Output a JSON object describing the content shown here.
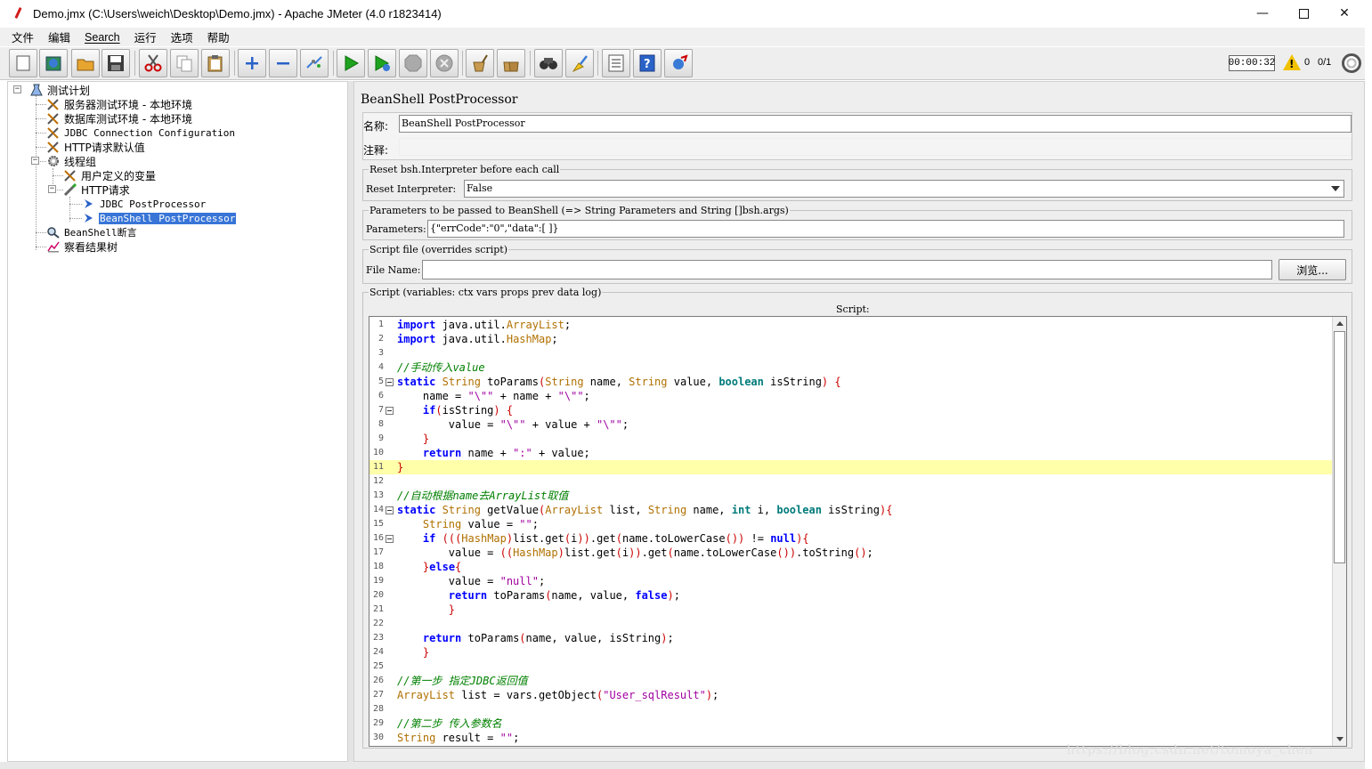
{
  "window": {
    "title": "Demo.jmx (C:\\Users\\weich\\Desktop\\Demo.jmx) - Apache JMeter (4.0 r1823414)",
    "minimize": "—",
    "close": "✕"
  },
  "menu": [
    "文件",
    "编辑",
    "Search",
    "运行",
    "选项",
    "帮助"
  ],
  "toolbar": {
    "buttons": [
      "new-icon",
      "templates-icon",
      "open-icon",
      "save-icon",
      "cut-icon",
      "copy-icon",
      "paste-icon",
      "expand-icon",
      "collapse-icon",
      "toggle-icon",
      "start-icon",
      "start-no-pause-icon",
      "stop-icon",
      "shutdown-icon",
      "clear-icon",
      "clear-all-icon",
      "search-icon",
      "reset-search-icon",
      "function-helper-icon",
      "help-icon",
      "remote-icon"
    ],
    "timer": "00:00:32",
    "warnings": "0",
    "threads": "0/1"
  },
  "tree": {
    "nodes": [
      {
        "label": "测试计划"
      },
      {
        "label": "服务器测试环境 - 本地环境"
      },
      {
        "label": "数据库测试环境 - 本地环境"
      },
      {
        "label": "JDBC Connection Configuration"
      },
      {
        "label": "HTTP请求默认值"
      },
      {
        "label": "线程组"
      },
      {
        "label": "用户定义的变量"
      },
      {
        "label": "HTTP请求"
      },
      {
        "label": "JDBC PostProcessor"
      },
      {
        "label": "BeanShell PostProcessor"
      },
      {
        "label": "BeanShell断言"
      },
      {
        "label": "察看结果树"
      }
    ]
  },
  "panel": {
    "title": "BeanShell PostProcessor",
    "name_label": "名称:",
    "name_value": "BeanShell PostProcessor",
    "comment_label": "注释:",
    "comment_value": "",
    "reset_group": "Reset bsh.Interpreter before each call",
    "reset_label": "Reset Interpreter:",
    "reset_value": "False",
    "params_group": "Parameters to be passed to BeanShell (=> String Parameters and String []bsh.args)",
    "params_label": "Parameters:",
    "params_value": "{\"errCode\":\"0\",\"data\":[ ]}",
    "file_group": "Script file (overrides script)",
    "file_label": "File Name:",
    "file_value": "",
    "browse_label": "浏览...",
    "script_group": "Script (variables: ctx vars props prev data log)",
    "script_label": "Script:"
  },
  "code_lines": [
    "import java.util.ArrayList;",
    "import java.util.HashMap;",
    "",
    "//手动传入value",
    "static String toParams(String name, String value, boolean isString) {",
    "    name = \"\\\"\" + name + \"\\\"\";",
    "    if(isString) {",
    "        value = \"\\\"\" + value + \"\\\"\";",
    "    }",
    "    return name + \":\" + value;",
    "}",
    "",
    "//自动根据name去ArrayList取值",
    "static String getValue(ArrayList list, String name, int i, boolean isString){",
    "    String value = \"\";",
    "    if (((HashMap)list.get(i)).get(name.toLowerCase()) != null){",
    "        value = ((HashMap)list.get(i)).get(name.toLowerCase()).toString();",
    "    }else{",
    "        value = \"null\";",
    "        return toParams(name, value, false);",
    "        }",
    "",
    "    return toParams(name, value, isString);",
    "    }",
    "",
    "//第一步 指定JDBC返回值",
    "ArrayList list = vars.getObject(\"User_sqlResult\");",
    "",
    "//第二步 传入参数名",
    "String result = \"\";"
  ],
  "highlighted_line": 11,
  "watermark": "https://blog.csdn.net/tomoya_chen"
}
